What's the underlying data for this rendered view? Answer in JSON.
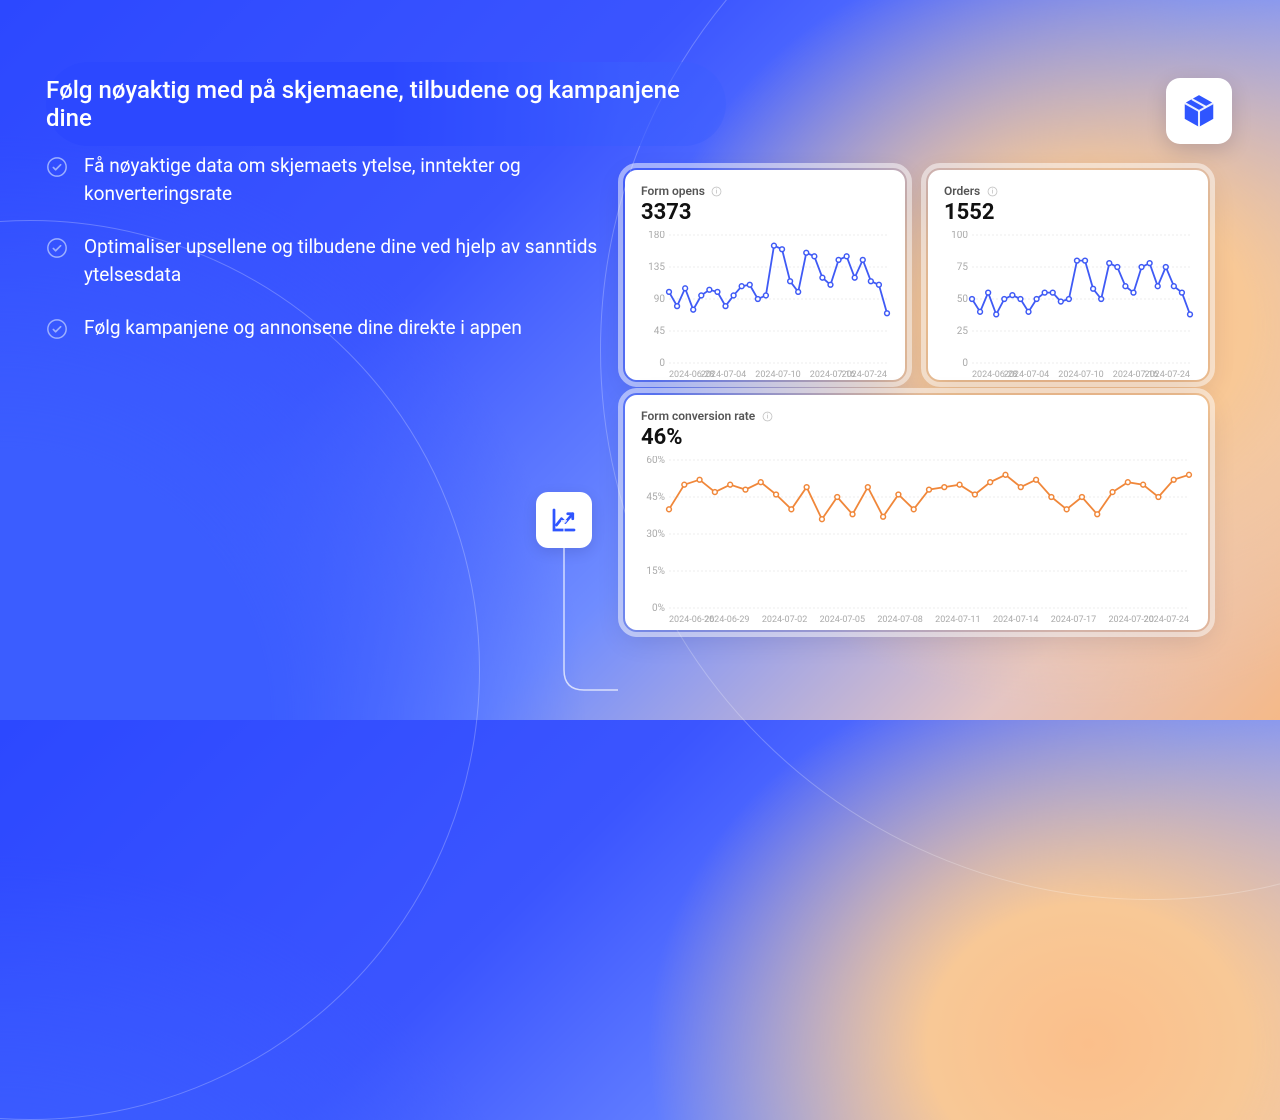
{
  "heading": "Følg nøyaktig med på skjemaene, tilbudene og kampanjene dine",
  "bullets": [
    "Få nøyaktige data om skjemaets ytelse, inntekter og konverteringsrate",
    "Optimaliser upsellene og tilbudene dine ved hjelp av sanntids ytelsesdata",
    "Følg kampanjene og annonsene dine direkte i appen"
  ],
  "icons": {
    "box_color": "#2f55ff",
    "chart_color": "#2f55ff",
    "line_blue": "#3f5af5",
    "line_orange": "#f0873a"
  },
  "chart_data": [
    {
      "id": "form_opens",
      "type": "line",
      "title": "Form opens",
      "value_label": "3373",
      "xlabel": "",
      "ylabel": "",
      "ylim": [
        0,
        180
      ],
      "yticks": [
        0,
        45,
        90,
        135,
        180
      ],
      "xticks": [
        "2024-06-28",
        "2024-07-04",
        "2024-07-10",
        "2024-07-16",
        "2024-07-24"
      ],
      "values": [
        100,
        80,
        105,
        75,
        95,
        103,
        100,
        80,
        95,
        108,
        110,
        90,
        95,
        165,
        160,
        115,
        100,
        155,
        150,
        120,
        110,
        145,
        150,
        120,
        145,
        115,
        110,
        70
      ],
      "color_key": "line_blue"
    },
    {
      "id": "orders",
      "type": "line",
      "title": "Orders",
      "value_label": "1552",
      "xlabel": "",
      "ylabel": "",
      "ylim": [
        0,
        100
      ],
      "yticks": [
        0,
        25,
        50,
        75,
        100
      ],
      "xticks": [
        "2024-06-28",
        "2024-07-04",
        "2024-07-10",
        "2024-07-16",
        "2024-07-24"
      ],
      "values": [
        50,
        40,
        55,
        38,
        50,
        53,
        50,
        40,
        50,
        55,
        55,
        48,
        50,
        80,
        80,
        58,
        50,
        78,
        75,
        60,
        55,
        75,
        78,
        60,
        75,
        60,
        55,
        38
      ],
      "color_key": "line_blue"
    },
    {
      "id": "form_conversion",
      "type": "line",
      "title": "Form conversion rate",
      "value_label": "46%",
      "xlabel": "",
      "ylabel": "",
      "ylim": [
        0,
        60
      ],
      "yticks": [
        "0%",
        "15%",
        "30%",
        "45%",
        "60%"
      ],
      "ytick_vals": [
        0,
        15,
        30,
        45,
        60
      ],
      "xticks": [
        "2024-06-26",
        "2024-06-29",
        "2024-07-02",
        "2024-07-05",
        "2024-07-08",
        "2024-07-11",
        "2024-07-14",
        "2024-07-17",
        "2024-07-20",
        "2024-07-24"
      ],
      "values": [
        40,
        50,
        52,
        47,
        50,
        48,
        51,
        46,
        40,
        49,
        36,
        45,
        38,
        49,
        37,
        46,
        40,
        48,
        49,
        50,
        46,
        51,
        54,
        49,
        52,
        45,
        40,
        45,
        38,
        47,
        51,
        50,
        45,
        52,
        54
      ],
      "color_key": "line_orange"
    }
  ]
}
